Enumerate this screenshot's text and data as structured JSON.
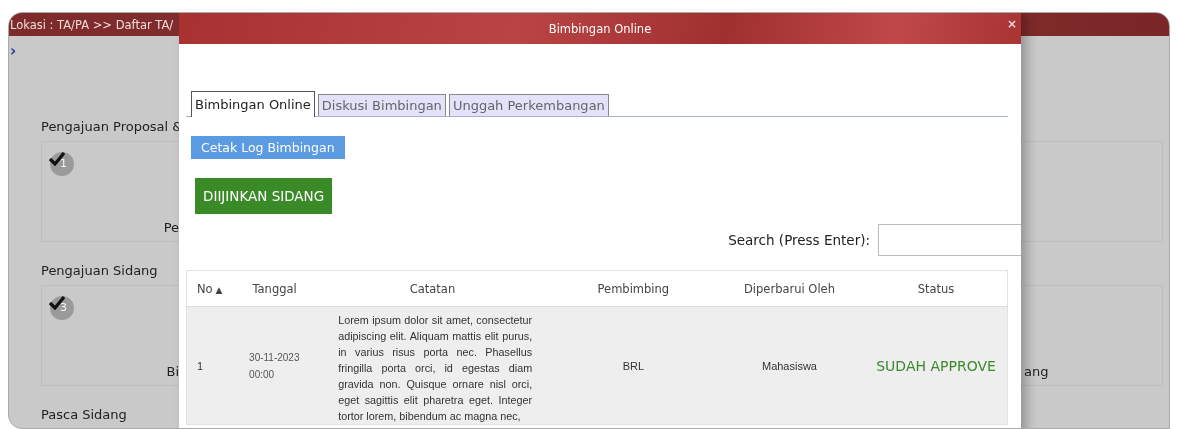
{
  "background_page": {
    "breadcrumb": "Lokasi : TA/PA >> Daftar TA/",
    "expand_chevron": "›",
    "sections": [
      {
        "title": "Pengajuan Proposal &",
        "step": "1",
        "done": true,
        "left_text": "Pe"
      },
      {
        "title": "Pengajuan Sidang",
        "step": "3",
        "done": true,
        "left_text": "Bi",
        "right_text": "ang"
      },
      {
        "title": "Pasca Sidang"
      }
    ]
  },
  "modal": {
    "title": "Bimbingan Online",
    "close": "×",
    "tabs": [
      {
        "label": "Bimbingan Online",
        "selected": true
      },
      {
        "label": "Diskusi Bimbingan",
        "selected": false
      },
      {
        "label": "Unggah Perkembangan",
        "selected": false
      }
    ],
    "print_button": "Cetak Log Bimbingan",
    "permit_button": "DIIJINKAN SIDANG",
    "search": {
      "label": "Search (Press Enter):"
    },
    "table": {
      "columns": [
        {
          "label": "No",
          "sort": "▲"
        },
        {
          "label": "Tanggal"
        },
        {
          "label": "Catatan"
        },
        {
          "label": "Pembimbing"
        },
        {
          "label": "Diperbarui Oleh"
        },
        {
          "label": "Status"
        }
      ],
      "rows": [
        {
          "no": "1",
          "date": "30-11-2023",
          "time": "00:00",
          "note": "Lorem ipsum dolor sit amet, consectetur adipiscing elit. Aliquam mattis elit purus, in varius risus porta nec. Phasellus fringilla porta orci, id egestas diam gravida non. Quisque ornare nisl orci, eget sagittis elit pharetra eget. Integer tortor lorem, bibendum ac magna nec,",
          "supervisor": "BRL",
          "updated_by": "Mahasiswa",
          "status": "SUDAH APPROVE"
        }
      ]
    }
  }
}
